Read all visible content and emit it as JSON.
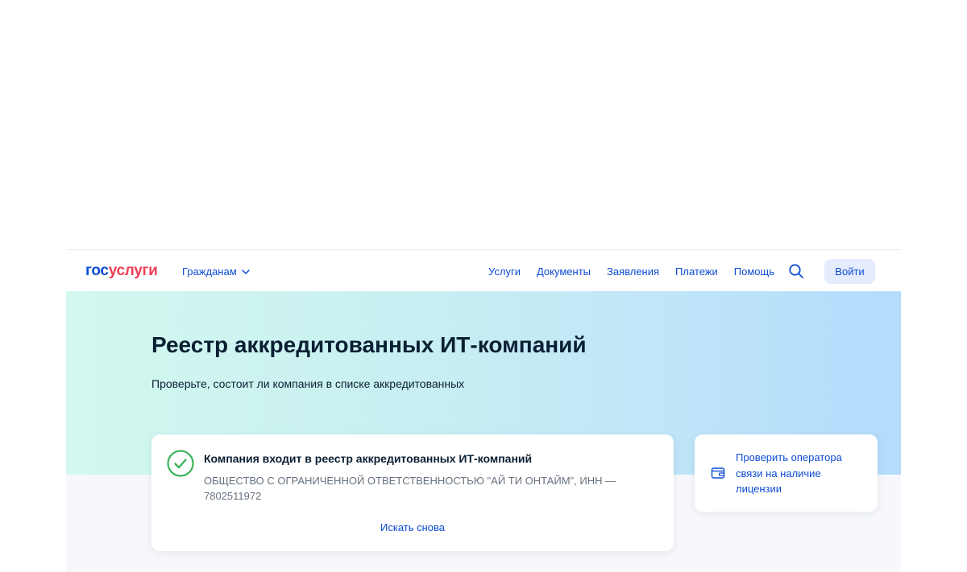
{
  "header": {
    "logo_part1": "гос",
    "logo_part2": "услуги",
    "audience_label": "Гражданам",
    "nav": [
      "Услуги",
      "Документы",
      "Заявления",
      "Платежи",
      "Помощь"
    ],
    "login_label": "Войти",
    "search_icon": "search-icon"
  },
  "hero": {
    "title": "Реестр аккредитованных ИТ-компаний",
    "subtitle": "Проверьте, состоит ли компания в списке аккредитованных"
  },
  "result": {
    "title": "Компания входит в реестр аккредитованных ИТ-компаний",
    "company": "ОБЩЕСТВО С ОГРАНИЧЕННОЙ ОТВЕТСТВЕННОСТЬЮ \"АЙ ТИ ОНТАЙМ\", ИНН — 7802511972",
    "search_again": "Искать снова",
    "status_icon": "check-circle-icon"
  },
  "side_card": {
    "text": "Проверить оператора связи на наличие лицензии",
    "icon": "wallet-icon"
  },
  "colors": {
    "brand_blue": "#0d4cd3",
    "brand_red": "#ee3f58",
    "success_green": "#3cb55c",
    "text_dark": "#0b1f33",
    "text_muted": "#66727f"
  }
}
